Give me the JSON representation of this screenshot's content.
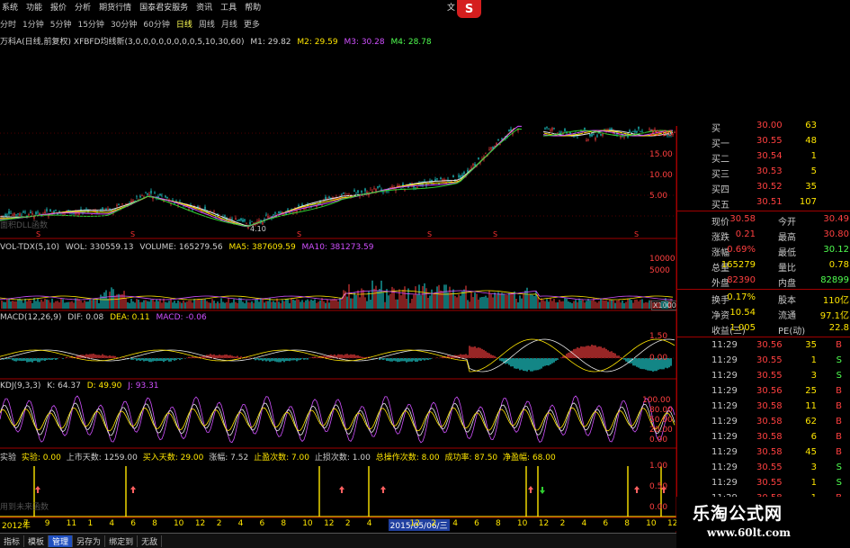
{
  "menu": {
    "items": [
      "系统",
      "功能",
      "报价",
      "分析",
      "期货行情",
      "国泰君安服务",
      "资讯",
      "工具",
      "帮助"
    ],
    "right_text": "文"
  },
  "periods": {
    "items": [
      "分时",
      "1分钟",
      "5分钟",
      "15分钟",
      "30分钟",
      "60分钟",
      "日线",
      "周线",
      "月线",
      "更多"
    ],
    "active": "日线"
  },
  "main_info": {
    "prefix": "万科A(日线,前复权) XFBFD均线新(3,0,0,0,0,0,0,0,0,5,10,30,60)",
    "m1": "M1: 29.82",
    "m2": "M2: 29.59",
    "m3": "M3: 30.28",
    "m4": "M4: 28.78"
  },
  "main_chart": {
    "low_label": "4.10",
    "ghost_label": "面积DLL函数",
    "y_ticks": [
      "20.00",
      "15.00",
      "10.00",
      "5.00"
    ],
    "markers": [
      "S",
      "S",
      "S",
      "S",
      "S",
      "S"
    ]
  },
  "vol_info": {
    "name": "VOL-TDX(5,10)",
    "wol": "WOL: 330559.13",
    "volume": "VOLUME: 165279.56",
    "ma5": "MA5: 387609.59",
    "ma10": "MA10: 381273.59"
  },
  "vol_axis": {
    "ticks": [
      "10000",
      "5000"
    ],
    "unit": "X1000"
  },
  "macd_info": {
    "name": "MACD(12,26,9)",
    "dif": "DIF: 0.08",
    "dea": "DEA: 0.11",
    "macd": "MACD: -0.06"
  },
  "macd_axis": {
    "ticks": [
      "1.50",
      "0.00"
    ]
  },
  "kdj_info": {
    "name": "KDJ(9,3,3)",
    "k": "K: 64.37",
    "d": "D: 49.90",
    "j": "J: 93.31"
  },
  "kdj_axis": {
    "ticks": [
      "100.00",
      "80.00",
      "50.00",
      "20.00",
      "0.00"
    ]
  },
  "signal_info": {
    "name": "实验",
    "label1": "实验: 0.00",
    "label2": "上市天数: 1259.00",
    "label3": "买入天数: 29.00",
    "label4": "涨幅: 7.52",
    "label5": "止盈次数: 7.00",
    "label6": "止损次数: 1.00",
    "label7": "总操作次数: 8.00",
    "label8": "成功率: 87.50",
    "label9": "净盈幅: 68.00",
    "ghost": "用到未来函数"
  },
  "signal_axis": {
    "ticks": [
      "1.00",
      "0.50",
      "0.00"
    ]
  },
  "x_axis": {
    "labels": [
      "2012年",
      "7",
      "9",
      "11",
      "1",
      "4",
      "6",
      "8",
      "10",
      "12",
      "2",
      "4",
      "6",
      "8",
      "10",
      "12",
      "2",
      "4",
      "2015/05/06/三",
      "12",
      "2",
      "4",
      "6",
      "8",
      "10",
      "12",
      "2",
      "4",
      "6",
      "8",
      "10",
      "12"
    ]
  },
  "quote": {
    "top_partial": {
      "label": "买",
      "price": "30.00",
      "vol": "63"
    },
    "bids": [
      {
        "label": "买一",
        "price": "30.55",
        "vol": "48"
      },
      {
        "label": "买二",
        "price": "30.54",
        "vol": "1"
      },
      {
        "label": "买三",
        "price": "30.53",
        "vol": "5"
      },
      {
        "label": "买四",
        "price": "30.52",
        "vol": "35"
      },
      {
        "label": "买五",
        "price": "30.51",
        "vol": "107"
      }
    ],
    "stats": [
      {
        "l1": "现价",
        "v1": "30.58",
        "l2": "今开",
        "v2": "30.49"
      },
      {
        "l1": "涨跌",
        "v1": "0.21",
        "l2": "最高",
        "v2": "30.80"
      },
      {
        "l1": "涨幅",
        "v1": "0.69%",
        "l2": "最低",
        "v2": "30.12"
      },
      {
        "l1": "总量",
        "v1": "165279",
        "l2": "量比",
        "v2": "0.78"
      },
      {
        "l1": "外盘",
        "v1": "82390",
        "l2": "内盘",
        "v2": "82899"
      }
    ],
    "fundamentals": [
      {
        "l1": "换手",
        "v1": "0.17%",
        "l2": "股本",
        "v2": "110亿"
      },
      {
        "l1": "净资",
        "v1": "10.54",
        "l2": "流通",
        "v2": "97.1亿"
      },
      {
        "l1": "收益(三)",
        "v1": "1.005",
        "l2": "PE(动)",
        "v2": "22.8"
      }
    ],
    "ticks": [
      {
        "t": "11:29",
        "p": "30.56",
        "v": "35",
        "s": "B"
      },
      {
        "t": "11:29",
        "p": "30.55",
        "v": "1",
        "s": "S"
      },
      {
        "t": "11:29",
        "p": "30.55",
        "v": "3",
        "s": "S"
      },
      {
        "t": "11:29",
        "p": "30.56",
        "v": "25",
        "s": "B"
      },
      {
        "t": "11:29",
        "p": "30.58",
        "v": "11",
        "s": "B"
      },
      {
        "t": "11:29",
        "p": "30.58",
        "v": "62",
        "s": "B"
      },
      {
        "t": "11:29",
        "p": "30.58",
        "v": "6",
        "s": "B"
      },
      {
        "t": "11:29",
        "p": "30.58",
        "v": "45",
        "s": "B"
      },
      {
        "t": "11:29",
        "p": "30.55",
        "v": "3",
        "s": "S"
      },
      {
        "t": "11:29",
        "p": "30.55",
        "v": "1",
        "s": "S"
      },
      {
        "t": "11:29",
        "p": "30.58",
        "v": "1",
        "s": "B"
      }
    ]
  },
  "bottom_tabs": {
    "items": [
      "指标",
      "模板",
      "管理",
      "另存为",
      "绑定到",
      "无敌"
    ],
    "selected": "管理"
  },
  "watermark": {
    "cn": "乐淘公式网",
    "url": "www.60lt.com"
  },
  "colors": {
    "up": "#ff4040",
    "down": "#20e0e0",
    "ma_white": "#e8e8e8",
    "ma_yellow": "#ffe600",
    "ma_magenta": "#d050ff",
    "ma_green": "#30d030"
  }
}
